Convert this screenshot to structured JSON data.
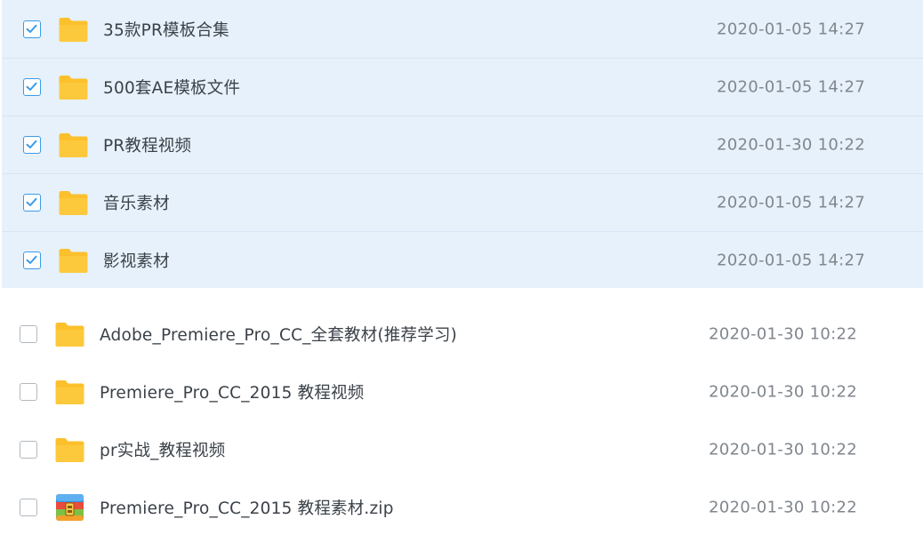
{
  "file_list": {
    "selected_items": [
      {
        "name": "35款PR模板合集",
        "date": "2020-01-05 14:27",
        "icon": "folder-icon",
        "checked": true
      },
      {
        "name": "500套AE模板文件",
        "date": "2020-01-05 14:27",
        "icon": "folder-icon",
        "checked": true
      },
      {
        "name": "PR教程视频",
        "date": "2020-01-30 10:22",
        "icon": "folder-icon",
        "checked": true
      },
      {
        "name": "音乐素材",
        "date": "2020-01-05 14:27",
        "icon": "folder-icon",
        "checked": true
      },
      {
        "name": "影视素材",
        "date": "2020-01-05 14:27",
        "icon": "folder-icon",
        "checked": true
      }
    ],
    "unselected_items": [
      {
        "name": "Adobe_Premiere_Pro_CC_全套教材(推荐学习)",
        "date": "2020-01-30 10:22",
        "icon": "folder-icon",
        "checked": false
      },
      {
        "name": "Premiere_Pro_CC_2015 教程视频",
        "date": "2020-01-30 10:22",
        "icon": "folder-icon",
        "checked": false
      },
      {
        "name": "pr实战_教程视频",
        "date": "2020-01-30 10:22",
        "icon": "folder-icon",
        "checked": false
      },
      {
        "name": "Premiere_Pro_CC_2015 教程素材.zip",
        "date": "2020-01-30 10:22",
        "icon": "zip-archive-icon",
        "checked": false
      }
    ]
  },
  "colors": {
    "selection_background": "#e6f1fb",
    "checkbox_accent": "#3a9bea",
    "folder_yellow": "#fcc02c",
    "name_text": "#3b4148",
    "date_text": "#80868d"
  }
}
